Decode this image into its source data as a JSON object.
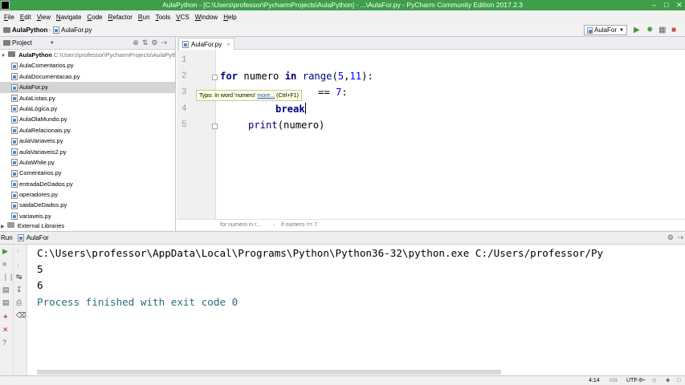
{
  "window": {
    "title": "AulaPython - [C:\\Users\\professor\\PycharmProjects\\AulaPython] - ...\\AulaFor.py - PyCharm Community Edition 2017.2.3"
  },
  "menu": [
    "File",
    "Edit",
    "View",
    "Navigate",
    "Code",
    "Refactor",
    "Run",
    "Tools",
    "VCS",
    "Window",
    "Help"
  ],
  "breadcrumb": {
    "project": "AulaPython",
    "file": "AulaFor.py"
  },
  "toolbar": {
    "run_config": "AulaFor"
  },
  "project_panel": {
    "title": "Project",
    "root_name": "AulaPython",
    "root_path": "C:\\Users\\professor\\PycharmProjects\\AulaPyth",
    "files": [
      "AulaComentarios.py",
      "AulaDocumentacao.py",
      "AulaFor.py",
      "AulaListas.py",
      "AulaLógica.py",
      "AulaOlaMundo.py",
      "AulaRelacionais.py",
      "aulaVariaveis.py",
      "aulaVariaveis2.py",
      "AulaWhile.py",
      "Comentarios.py",
      "entradaDeDados.py",
      "operadores.py",
      "saidaDeDados.py",
      "variaveis.py"
    ],
    "selected": "AulaFor.py",
    "external": "External Libraries"
  },
  "editor": {
    "tab": "AulaFor.py",
    "line_numbers": [
      "1",
      "2",
      "3",
      "4",
      "5"
    ],
    "code": {
      "l2_for": "for",
      "l2_var": " numero ",
      "l2_in": "in",
      "l2_range": " range",
      "l2_paren": "(",
      "l2_n1": "5",
      "l2_comma": ",",
      "l2_n2": "11",
      "l2_end": "):",
      "l3_rest": "== ",
      "l3_num": "7",
      "l3_colon": ":",
      "l4_break": "break",
      "l5_print": "print",
      "l5_rest": "(numero)"
    },
    "tooltip": {
      "text": "Typo: In word 'numero'",
      "link": "more...",
      "shortcut": "(Ctrl+F1)"
    },
    "status_crumbs": [
      "for numero in r...",
      "if numero == 7"
    ]
  },
  "run_panel": {
    "label": "Run",
    "config": "AulaFor",
    "console": [
      "C:\\Users\\professor\\AppData\\Local\\Programs\\Python\\Python36-32\\python.exe C:/Users/professor/Py",
      "5",
      "6",
      "",
      "Process finished with exit code 0"
    ]
  },
  "status_bar": {
    "position": "4:14",
    "line_sep": "n/a",
    "encoding": "UTF-8÷"
  }
}
